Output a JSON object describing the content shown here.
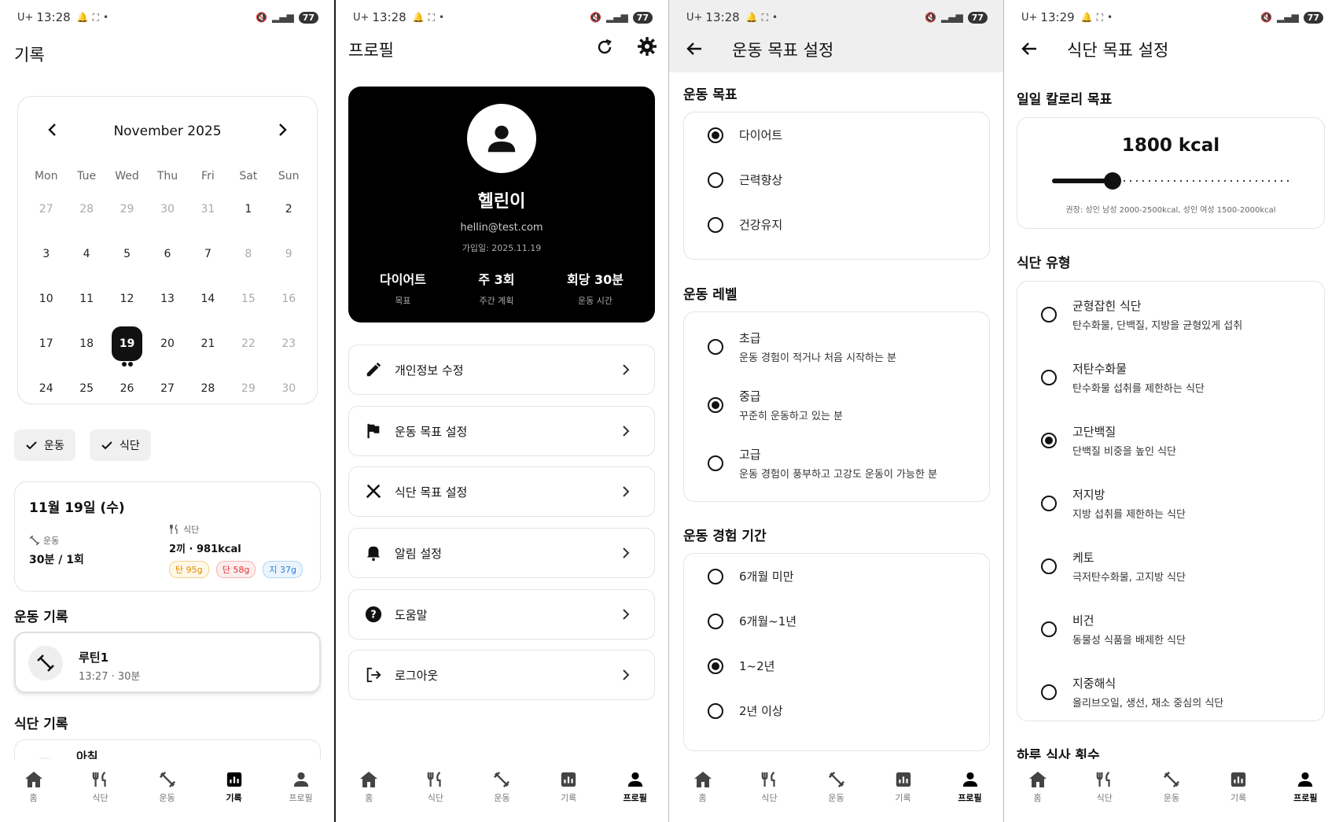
{
  "status_bars": [
    {
      "carrier": "U+",
      "time": "13:28",
      "battery": "77"
    },
    {
      "carrier": "U+",
      "time": "13:28",
      "battery": "77"
    },
    {
      "carrier": "U+",
      "time": "13:28",
      "battery": "77"
    },
    {
      "carrier": "U+",
      "time": "13:29",
      "battery": "77"
    }
  ],
  "nav": {
    "home": "홈",
    "diet": "식단",
    "workout": "운동",
    "record": "기록",
    "profile": "프로필"
  },
  "record_screen": {
    "title": "기록",
    "month_label": "November 2025",
    "weekdays": [
      "Mon",
      "Tue",
      "Wed",
      "Thu",
      "Fri",
      "Sat",
      "Sun"
    ],
    "weeks": [
      [
        "27",
        "28",
        "29",
        "30",
        "31",
        "1",
        "2"
      ],
      [
        "3",
        "4",
        "5",
        "6",
        "7",
        "8",
        "9"
      ],
      [
        "10",
        "11",
        "12",
        "13",
        "14",
        "15",
        "16"
      ],
      [
        "17",
        "18",
        "19",
        "20",
        "21",
        "22",
        "23"
      ],
      [
        "24",
        "25",
        "26",
        "27",
        "28",
        "29",
        "30"
      ]
    ],
    "selected_day": "19",
    "filter_chips": [
      "운동",
      "식단"
    ],
    "summary": {
      "date": "11월 19일 (수)",
      "workout_label": "운동",
      "workout_value": "30분 / 1회",
      "diet_label": "식단",
      "diet_value": "2끼 · 981kcal",
      "carb": "탄 95g",
      "protein": "단 58g",
      "fat": "지 37g"
    },
    "workout_section": "운동 기록",
    "workout_item": {
      "name": "루틴1",
      "meta": "13:27 · 30분"
    },
    "diet_section": "식단 기록",
    "diet_item": {
      "name": "아침"
    }
  },
  "profile_screen": {
    "title": "프로필",
    "name": "헬린이",
    "email": "hellin@test.com",
    "joined": "가입일: 2025.11.19",
    "stats": [
      {
        "value": "다이어트",
        "label": "목표"
      },
      {
        "value": "주 3회",
        "label": "주간 계획"
      },
      {
        "value": "회당 30분",
        "label": "운동 시간"
      }
    ],
    "menu": [
      "개인정보 수정",
      "운동 목표 설정",
      "식단 목표 설정",
      "알림 설정",
      "도움말",
      "로그아웃"
    ]
  },
  "workout_goal_screen": {
    "title": "운동 목표 설정",
    "goal_section": "운동 목표",
    "goals": [
      "다이어트",
      "근력향상",
      "건강유지"
    ],
    "goal_selected": 0,
    "level_section": "운동 레벨",
    "levels": [
      {
        "label": "초급",
        "desc": "운동 경험이 적거나 처음 시작하는 분"
      },
      {
        "label": "중급",
        "desc": "꾸준히 운동하고 있는 분"
      },
      {
        "label": "고급",
        "desc": "운동 경험이 풍부하고 고강도 운동이 가능한 분"
      }
    ],
    "level_selected": 1,
    "exp_section": "운동 경험 기간",
    "exps": [
      "6개월 미만",
      "6개월~1년",
      "1~2년",
      "2년 이상"
    ],
    "exp_selected": 2
  },
  "diet_goal_screen": {
    "title": "식단 목표 설정",
    "calorie_section": "일일 칼로리 목표",
    "calorie_value": "1800 kcal",
    "calorie_level": 0.25,
    "calorie_hint": "권장: 성인 남성 2000-2500kcal, 성인 여성 1500-2000kcal",
    "type_section": "식단 유형",
    "types": [
      {
        "label": "균형잡힌 식단",
        "desc": "탄수화물, 단백질, 지방을 균형있게 섭취"
      },
      {
        "label": "저탄수화물",
        "desc": "탄수화물 섭취를 제한하는 식단"
      },
      {
        "label": "고단백질",
        "desc": "단백질 비중을 높인 식단"
      },
      {
        "label": "저지방",
        "desc": "지방 섭취를 제한하는 식단"
      },
      {
        "label": "케토",
        "desc": "극저탄수화물, 고지방 식단"
      },
      {
        "label": "비건",
        "desc": "동물성 식품을 배제한 식단"
      },
      {
        "label": "지중해식",
        "desc": "올리브오일, 생선, 채소 중심의 식단"
      }
    ],
    "type_selected": 2,
    "meals_section": "하루 식사 횟수"
  }
}
